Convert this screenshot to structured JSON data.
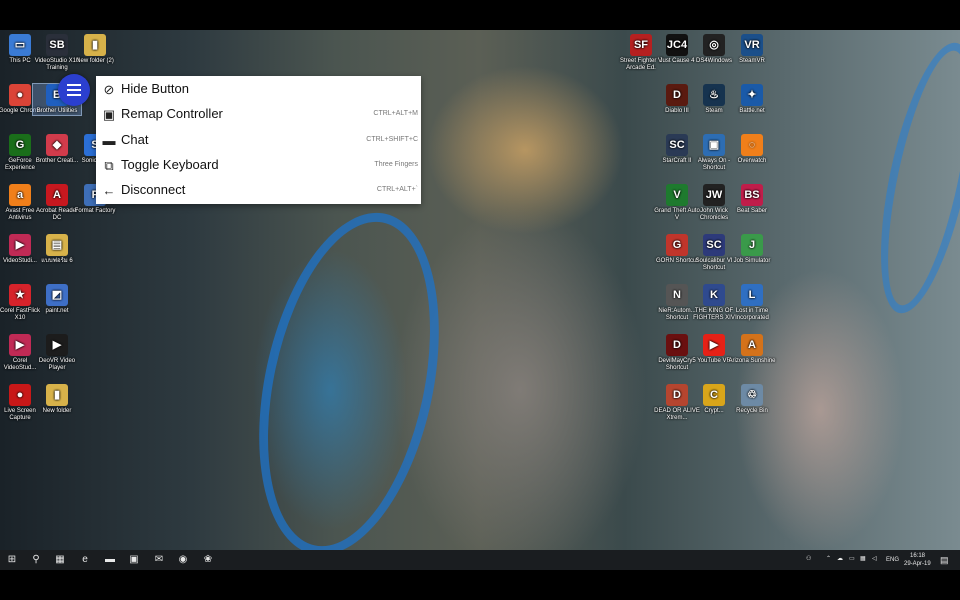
{
  "left_icons": [
    {
      "label": "This PC",
      "glyph": "▭",
      "color": "#3a7bd5"
    },
    {
      "label": "VideoStudio X10 Training",
      "glyph": "SB",
      "color": "#2a2f3a"
    },
    {
      "label": "New folder (2)",
      "glyph": "▮",
      "color": "#d7b24a"
    },
    {
      "label": "Google Chrome",
      "glyph": "●",
      "color": "#db4437"
    },
    {
      "label": "Brother Utilities",
      "glyph": "B",
      "color": "#1f5fbf"
    },
    {
      "label": "GeForce Experience",
      "glyph": "G",
      "color": "#1a6e1a"
    },
    {
      "label": "Brother Creati...",
      "glyph": "◆",
      "color": "#d13b4b"
    },
    {
      "label": "Sonic M...",
      "glyph": "S",
      "color": "#2b6fd6"
    },
    {
      "label": "Avast Free Antivirus",
      "glyph": "a",
      "color": "#f07f1a"
    },
    {
      "label": "Acrobat Reader DC",
      "glyph": "A",
      "color": "#c7181f"
    },
    {
      "label": "Format Factory",
      "glyph": "F",
      "color": "#3e6fb8"
    },
    {
      "label": "VideoStudi...",
      "glyph": "▶",
      "color": "#c02a55"
    },
    {
      "label": "แบบฟอร์ม 6",
      "glyph": "▤",
      "color": "#d7b24a"
    },
    {
      "label": "Corel FastFlick X10",
      "glyph": "★",
      "color": "#d6232b"
    },
    {
      "label": "paint.net",
      "glyph": "◩",
      "color": "#3e6fc6"
    },
    {
      "label": "Corel VideoStud...",
      "glyph": "▶",
      "color": "#c02a55"
    },
    {
      "label": "DeoVR Video Player",
      "glyph": "▶",
      "color": "#1c1c1c"
    },
    {
      "label": "Live Screen Capture",
      "glyph": "●",
      "color": "#c81818"
    },
    {
      "label": "New folder",
      "glyph": "▮",
      "color": "#d7b24a"
    }
  ],
  "right_icons": [
    {
      "label": "Street Fighter V Arcade Ed.",
      "glyph": "SF",
      "color": "#b52020"
    },
    {
      "label": "Just Cause 4",
      "glyph": "JC4",
      "color": "#111111"
    },
    {
      "label": "DS4Windows",
      "glyph": "◎",
      "color": "#222222"
    },
    {
      "label": "SteamVR",
      "glyph": "VR",
      "color": "#1b4f8a"
    },
    {
      "label": "Diablo III",
      "glyph": "D",
      "color": "#5a1a10"
    },
    {
      "label": "Steam",
      "glyph": "♨",
      "color": "#16334f"
    },
    {
      "label": "Battle.net",
      "glyph": "✦",
      "color": "#1a5aa8"
    },
    {
      "label": "StarCraft II",
      "glyph": "SC",
      "color": "#2a3a55"
    },
    {
      "label": "Always On - Shortcut",
      "glyph": "▣",
      "color": "#2d6db3"
    },
    {
      "label": "Overwatch",
      "glyph": "◌",
      "color": "#f07f1a"
    },
    {
      "label": "Grand Theft Auto V",
      "glyph": "V",
      "color": "#1e7a2e"
    },
    {
      "label": "John Wick Chronicles",
      "glyph": "JW",
      "color": "#222222"
    },
    {
      "label": "Beat Saber",
      "glyph": "BS",
      "color": "#c01d4a"
    },
    {
      "label": "GORN Shortcut",
      "glyph": "G",
      "color": "#c0352b"
    },
    {
      "label": "Soulcalibur VI Shortcut",
      "glyph": "SC",
      "color": "#2d3a7a"
    },
    {
      "label": "Job Simulator",
      "glyph": "J",
      "color": "#3a9a4a"
    },
    {
      "label": "NieR:Autom... Shortcut",
      "glyph": "N",
      "color": "#555555"
    },
    {
      "label": "THE KING OF FIGHTERS XIV",
      "glyph": "K",
      "color": "#2f4a8e"
    },
    {
      "label": "Lost in Time Incorporated",
      "glyph": "L",
      "color": "#2f6fc2"
    },
    {
      "label": "DevilMayCry5 Shortcut",
      "glyph": "D",
      "color": "#6a1010"
    },
    {
      "label": "YouTube VR",
      "glyph": "▶",
      "color": "#e62117"
    },
    {
      "label": "Arizona Sunshine",
      "glyph": "A",
      "color": "#d4721a"
    },
    {
      "label": "DEAD OR ALIVE Xtrem...",
      "glyph": "D",
      "color": "#b5452f"
    },
    {
      "label": "Crypt...",
      "glyph": "C",
      "color": "#d9a51a"
    },
    {
      "label": "Recycle Bin",
      "glyph": "♲",
      "color": "#6d8aa5"
    }
  ],
  "menu": [
    {
      "icon": "eye-off",
      "glyph": "⊘",
      "label": "Hide Button",
      "shortcut": ""
    },
    {
      "icon": "gamepad",
      "glyph": "▣",
      "label": "Remap Controller",
      "shortcut": "CTRL+ALT+M"
    },
    {
      "icon": "chat",
      "glyph": "▬",
      "label": "Chat",
      "shortcut": "CTRL+SHIFT+C"
    },
    {
      "icon": "keyboard",
      "glyph": "⧉",
      "label": "Toggle Keyboard",
      "shortcut": "Three Fingers"
    },
    {
      "icon": "arrow-left",
      "glyph": "←",
      "label": "Disconnect",
      "shortcut": "CTRL+ALT+`"
    }
  ],
  "taskbar": {
    "apps": [
      {
        "icon": "windows-start",
        "glyph": "⊞"
      },
      {
        "icon": "search",
        "glyph": "⚲"
      },
      {
        "icon": "task-view",
        "glyph": "▦"
      },
      {
        "icon": "edge",
        "glyph": "e"
      },
      {
        "icon": "file-explorer",
        "glyph": "▬"
      },
      {
        "icon": "store",
        "glyph": "▣"
      },
      {
        "icon": "mail",
        "glyph": "✉"
      },
      {
        "icon": "chrome",
        "glyph": "◉"
      },
      {
        "icon": "app",
        "glyph": "❀"
      }
    ],
    "language": "ENG",
    "time": "16:18",
    "date": "29-Apr-19"
  },
  "colors": {
    "accent": "#2b3fcf",
    "taskbar": "#1a1d20",
    "menu_bg": "#ffffff"
  }
}
